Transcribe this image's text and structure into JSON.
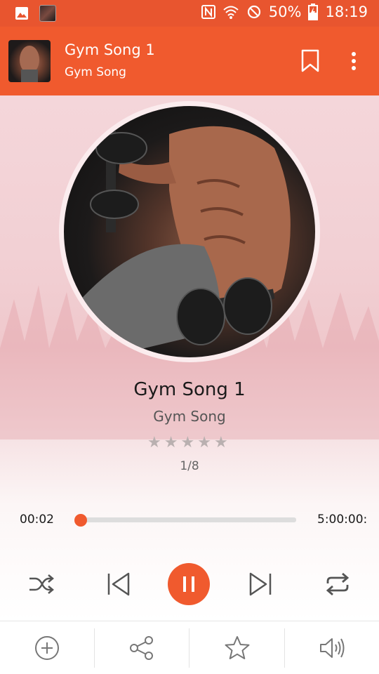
{
  "status_bar": {
    "battery": "50%",
    "time": "18:19",
    "icons": [
      "gallery-icon",
      "nfc-icon",
      "wifi-icon",
      "do-not-disturb-icon",
      "battery-charging-icon"
    ]
  },
  "toolbar": {
    "title": "Gym Song 1",
    "subtitle": "Gym Song",
    "icons": [
      "bookmark-icon",
      "more-vert-icon"
    ]
  },
  "player": {
    "song_title": "Gym Song 1",
    "artist": "Gym Song",
    "rating": 0,
    "rating_max": 5,
    "track_count": "1/8",
    "current_time": "00:02",
    "total_time": "5:00:00:",
    "progress_fraction": 0.01
  },
  "controls": [
    "shuffle-icon",
    "previous-icon",
    "pause-icon",
    "next-icon",
    "repeat-icon"
  ],
  "bottom_bar": [
    "add-icon",
    "share-icon",
    "favorite-star-icon",
    "volume-icon"
  ],
  "colors": {
    "accent": "#f05a2e",
    "statusbar": "#e8552f"
  }
}
